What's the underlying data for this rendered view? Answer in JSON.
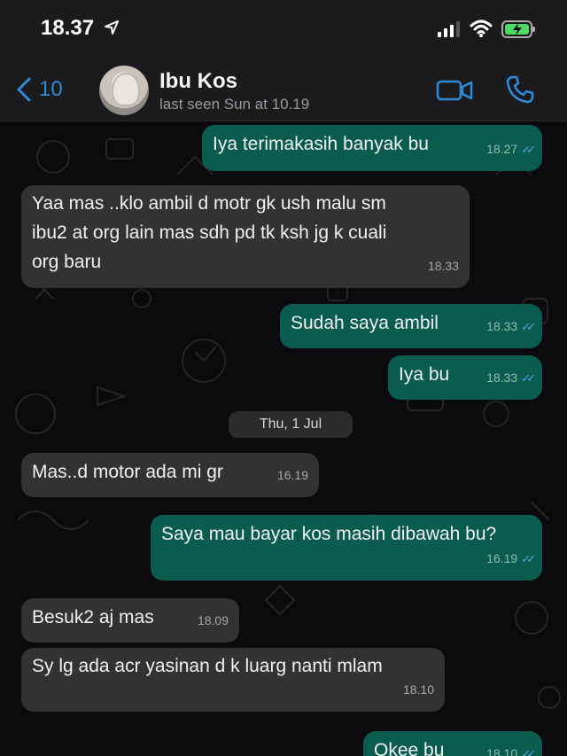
{
  "status_bar": {
    "time": "18.37"
  },
  "header": {
    "back_count": "10",
    "contact_name": "Ibu Kos",
    "last_seen": "last seen Sun at 10.19"
  },
  "messages": [
    {
      "dir": "out",
      "lines": [
        "Iya terimakasih banyak bu"
      ],
      "time": "18.27"
    },
    {
      "dir": "in",
      "lines": [
        "Yaa mas ..klo ambil d motr  gk ush malu sm",
        "ibu2 at org lain mas sdh pd tk ksh jg  k cuali",
        "org baru"
      ],
      "time": "18.33"
    },
    {
      "dir": "out",
      "lines": [
        "Sudah saya ambil"
      ],
      "time": "18.33"
    },
    {
      "dir": "out",
      "lines": [
        "Iya bu"
      ],
      "time": "18.33"
    },
    {
      "dir": "in",
      "lines": [
        "Mas..d motor ada mi gr"
      ],
      "time": "16.19"
    },
    {
      "dir": "out",
      "lines": [
        "Saya mau bayar kos masih dibawah bu?"
      ],
      "time": "16.19"
    },
    {
      "dir": "in",
      "lines": [
        "Besuk2 aj mas"
      ],
      "time": "18.09"
    },
    {
      "dir": "in",
      "lines": [
        "Sy lg ada acr yasinan d k luarg  nanti mlam"
      ],
      "time": "18.10"
    },
    {
      "dir": "out",
      "lines": [
        "Okee bu"
      ],
      "time": "18.10"
    }
  ],
  "date_separator": "Thu, 1 Jul",
  "colors": {
    "incoming_bubble": "#323235",
    "outgoing_bubble": "#0a5c4f",
    "accent_blue": "#2f8bd8",
    "read_ticks": "#4aa8e8"
  }
}
